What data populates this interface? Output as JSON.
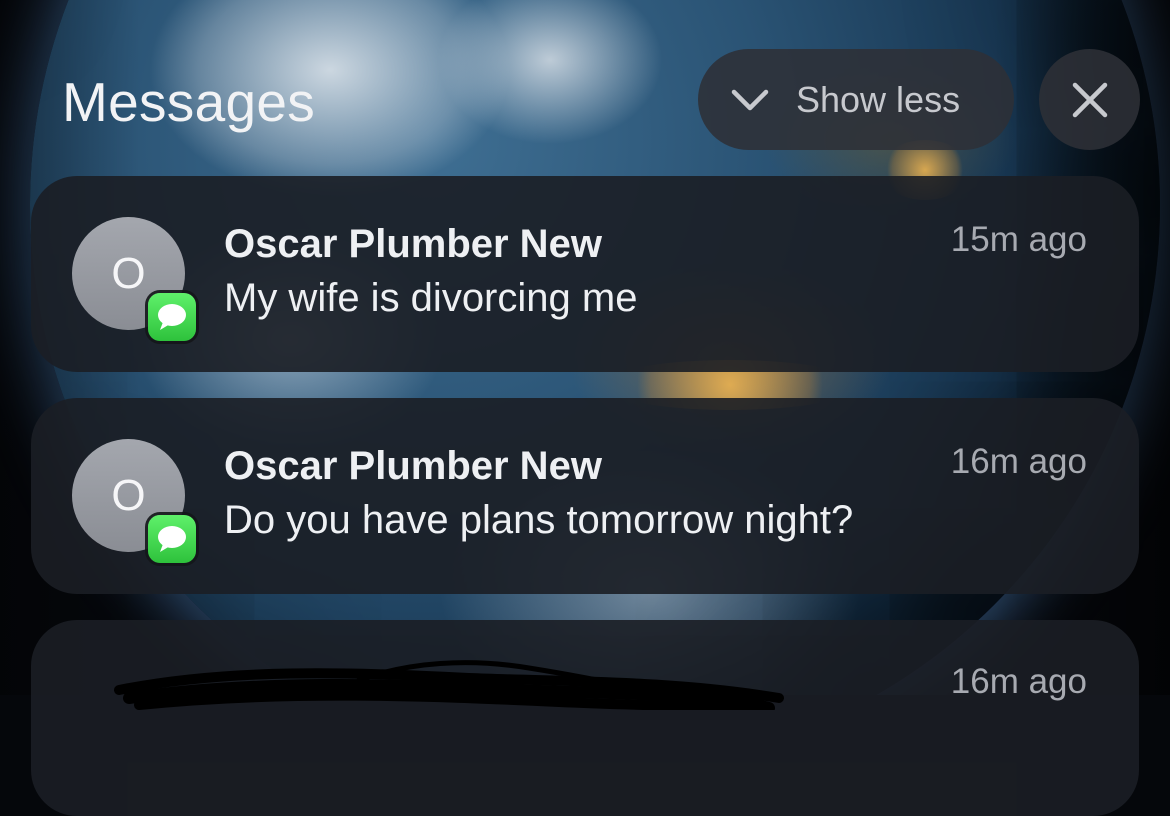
{
  "header": {
    "title": "Messages",
    "show_less_label": "Show less"
  },
  "notifications": [
    {
      "avatar_initial": "O",
      "sender": "Oscar Plumber New",
      "time": "15m ago",
      "message": "My wife is divorcing me",
      "app_icon": "messages-icon"
    },
    {
      "avatar_initial": "O",
      "sender": "Oscar Plumber New",
      "time": "16m ago",
      "message": "Do you have plans tomorrow night?",
      "app_icon": "messages-icon"
    },
    {
      "time": "16m ago",
      "redacted": true
    }
  ],
  "colors": {
    "card_background": "#1b1e25",
    "badge_green": "#34c759",
    "avatar_gray": "#989ba2"
  }
}
